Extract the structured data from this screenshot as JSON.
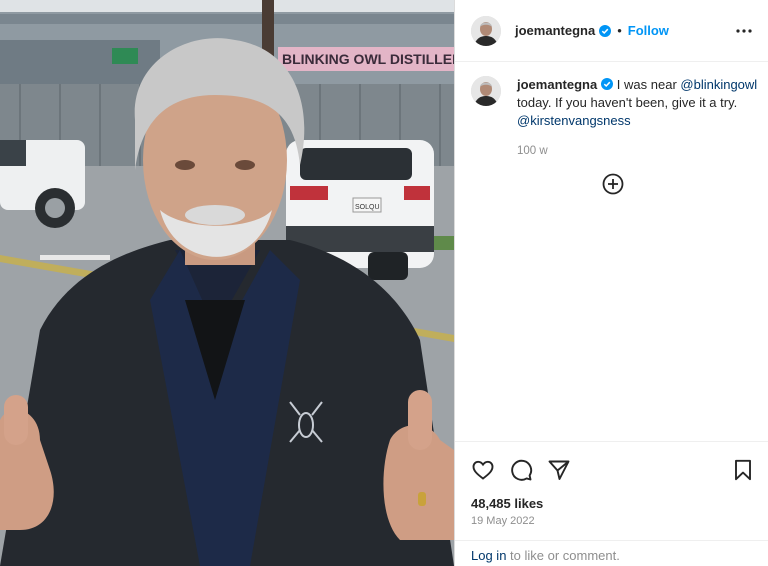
{
  "post": {
    "username": "joemantegna",
    "follow_label": "Follow",
    "dot": "•",
    "caption_text_1": " I was near ",
    "mention_1": "@blinkingowl",
    "caption_text_2": " today. If you haven't been, give it a try. ",
    "mention_2": "@kirstenvangsness",
    "time_ago": "100 w",
    "likes": "48,485 likes",
    "date": "19 May 2022"
  },
  "photo": {
    "sign_text": "BLINKING OWL DISTILLERY",
    "street_sign_text": "—",
    "plate_text": "SOLQU"
  },
  "login": {
    "link_label": "Log in",
    "rest_label": " to like or comment."
  },
  "colors": {
    "accent": "#0095f6",
    "mention": "#00376b",
    "muted": "#8e8e8e"
  }
}
